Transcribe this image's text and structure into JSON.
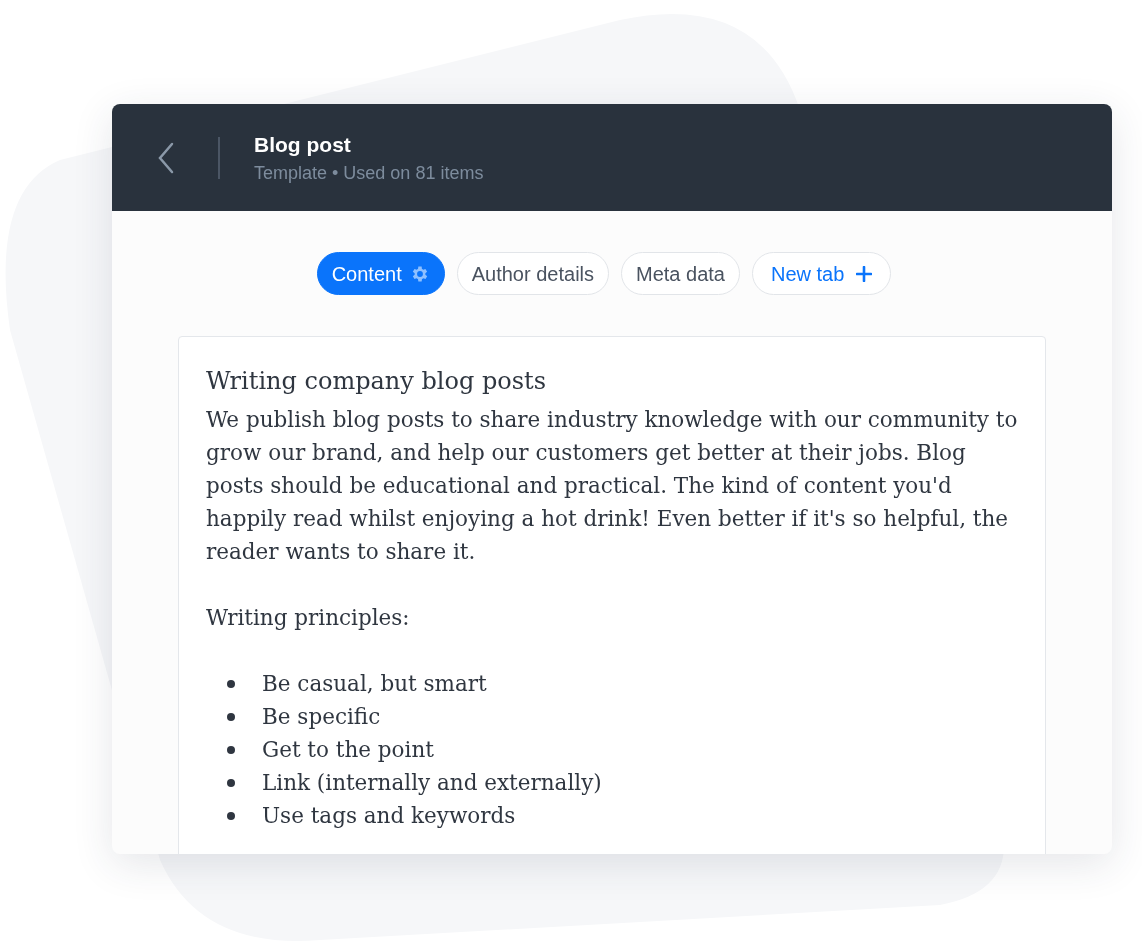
{
  "header": {
    "title": "Blog post",
    "subtitle": "Template • Used on 81 items"
  },
  "tabs": [
    {
      "label": "Content",
      "selected": true,
      "kind": "tab"
    },
    {
      "label": "Author details",
      "selected": false,
      "kind": "tab"
    },
    {
      "label": "Meta data",
      "selected": false,
      "kind": "tab"
    },
    {
      "label": "New tab",
      "selected": false,
      "kind": "add"
    }
  ],
  "document": {
    "heading": "Writing company blog posts",
    "paragraphs": [
      "We publish blog posts to share industry knowledge with our community to grow our brand, and help our customers get better at their jobs. Blog posts should be educational and practical. The kind of content you'd happily read whilst enjoying a hot drink! Even better if it's so helpful, the reader wants to share it.",
      "Writing principles:"
    ],
    "list": [
      "Be casual, but smart",
      "Be specific",
      "Get to the point",
      "Link (internally and externally)",
      "Use tags and keywords"
    ]
  }
}
